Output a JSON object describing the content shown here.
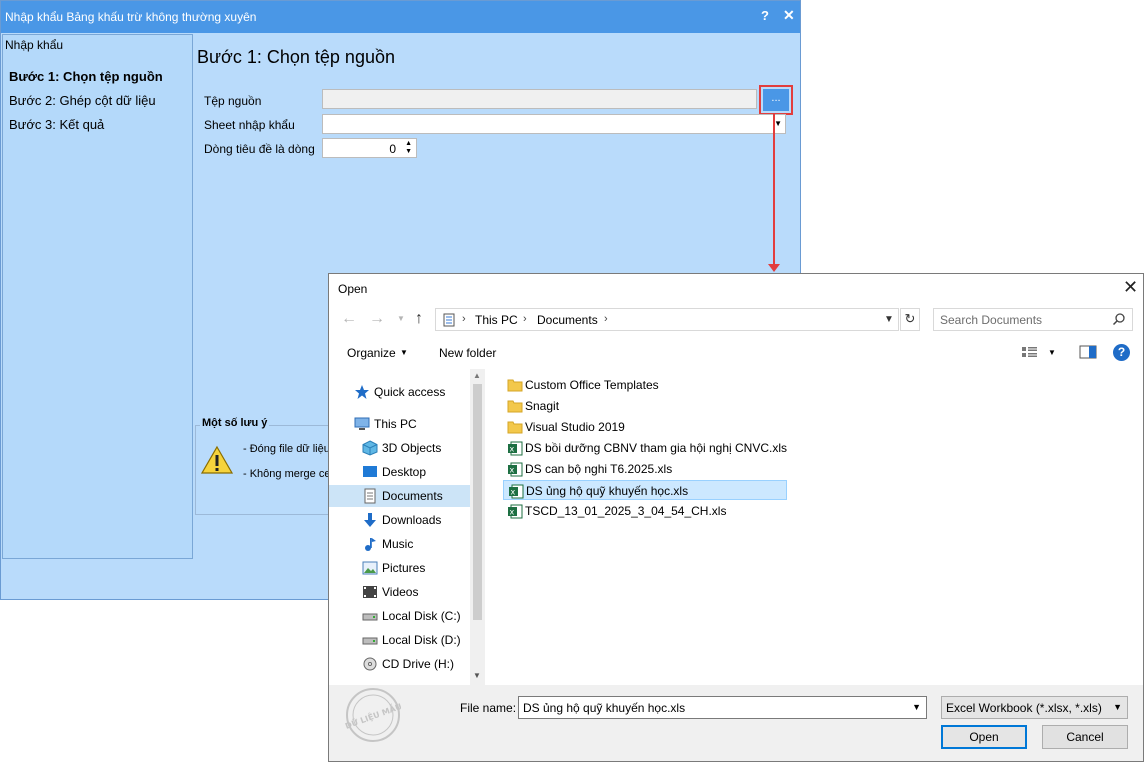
{
  "background_window": {
    "title": "Nhập khẩu Bảng khấu trừ không thường xuyên",
    "help_label": "?",
    "close_label": "✕",
    "sidebar": {
      "header": "Nhập khẩu",
      "steps": [
        "Bước 1: Chọn tệp nguồn",
        "Bước 2: Ghép cột dữ liệu",
        "Bước 3: Kết quả"
      ]
    },
    "heading": "Bước 1: Chọn tệp nguồn",
    "source_file_label": "Tệp nguồn",
    "source_file_value": "",
    "browse_label": "...",
    "sheet_label": "Sheet nhập khẩu",
    "sheet_value": "",
    "header_row_label": "Dòng tiêu đề là dòng",
    "header_row_value": "0",
    "notes": {
      "title": "Một số lưu ý",
      "items": [
        "- Đóng file dữ liệu",
        "- Không merge ce"
      ]
    }
  },
  "open_dialog": {
    "title": "Open",
    "close_label": "✕",
    "breadcrumb": [
      "This PC",
      "Documents"
    ],
    "search_placeholder": "Search Documents",
    "toolbar": {
      "organize": "Organize",
      "new_folder": "New folder",
      "help": "?"
    },
    "nav_items": [
      {
        "label": "Quick access",
        "icon": "star-icon",
        "indent": 1
      },
      {
        "label": "This PC",
        "icon": "pc-icon",
        "indent": 1
      },
      {
        "label": "3D Objects",
        "icon": "cube-icon",
        "indent": 2
      },
      {
        "label": "Desktop",
        "icon": "desktop-icon",
        "indent": 2
      },
      {
        "label": "Documents",
        "icon": "documents-icon",
        "indent": 2,
        "selected": true
      },
      {
        "label": "Downloads",
        "icon": "download-icon",
        "indent": 2
      },
      {
        "label": "Music",
        "icon": "music-icon",
        "indent": 2
      },
      {
        "label": "Pictures",
        "icon": "pictures-icon",
        "indent": 2
      },
      {
        "label": "Videos",
        "icon": "videos-icon",
        "indent": 2
      },
      {
        "label": "Local Disk (C:)",
        "icon": "disk-icon",
        "indent": 2
      },
      {
        "label": "Local Disk (D:)",
        "icon": "disk-icon",
        "indent": 2
      },
      {
        "label": "CD Drive (H:)",
        "icon": "cd-icon",
        "indent": 2
      }
    ],
    "files": [
      {
        "name": "Custom Office Templates",
        "type": "folder"
      },
      {
        "name": "Snagit",
        "type": "folder"
      },
      {
        "name": "Visual Studio 2019",
        "type": "folder"
      },
      {
        "name": "DS bồi dưỡng CBNV tham gia hội nghị CNVC.xls",
        "type": "excel"
      },
      {
        "name": "DS can bộ nghi T6.2025.xls",
        "type": "excel"
      },
      {
        "name": "DS ủng hộ quỹ khuyến học.xls",
        "type": "excel",
        "selected": true
      },
      {
        "name": "TSCD_13_01_2025_3_04_54_CH.xls",
        "type": "excel"
      }
    ],
    "file_name_label": "File name:",
    "file_name_value": "DS ủng hộ quỹ khuyến học.xls",
    "file_type_value": "Excel Workbook (*.xlsx, *.xls)",
    "open_label": "Open",
    "cancel_label": "Cancel",
    "watermark": "DỮ LIỆU MẪU"
  },
  "colors": {
    "bg_window": "#b9dbfb",
    "bg_titlebar": "#4a97e6",
    "highlight_red": "#e23d3d",
    "selection": "#cce8ff",
    "accent": "#0078d7"
  }
}
